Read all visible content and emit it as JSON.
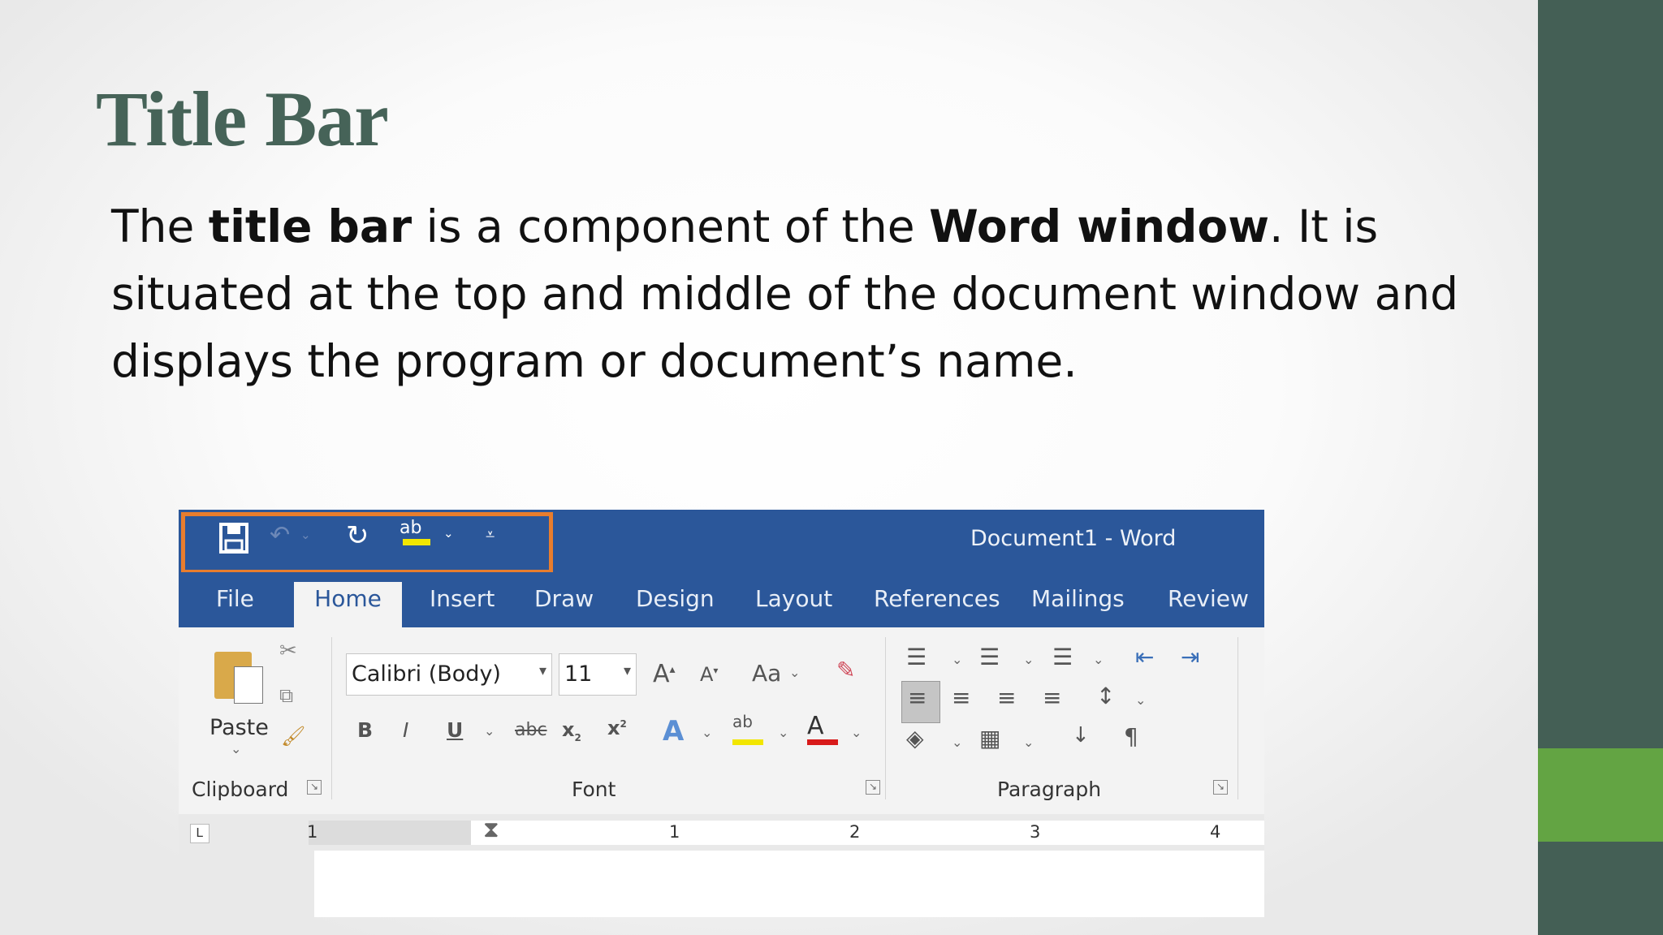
{
  "slide": {
    "title": "Title Bar",
    "body": {
      "p1": "The ",
      "b1": "title bar",
      "p2": " is a component of the ",
      "b2": "Word window",
      "p3": ". It is situated at the top and middle of the document window and displays the program or document’s name."
    }
  },
  "colors": {
    "title": "#466358",
    "sidebar": "#445f55",
    "sidebar_accent": "#63a443",
    "word_blue": "#2b579a",
    "highlight_box": "#e87d2e"
  },
  "word": {
    "title": "Document1  -  Word",
    "quick_access": {
      "icons": [
        "save-icon",
        "undo-icon",
        "redo-icon",
        "spelling-icon",
        "customize-icon"
      ]
    },
    "tabs": [
      "File",
      "Home",
      "Insert",
      "Draw",
      "Design",
      "Layout",
      "References",
      "Mailings",
      "Review"
    ],
    "active_tab": "Home",
    "ribbon": {
      "clipboard": {
        "paste": "Paste",
        "label": "Clipboard"
      },
      "font": {
        "name": "Calibri (Body)",
        "size": "11",
        "change_case": "Aa",
        "label": "Font",
        "bold": "B",
        "italic": "I",
        "underline": "U",
        "strike": "abc",
        "subscript": "x",
        "superscript": "x"
      },
      "paragraph": {
        "label": "Paragraph",
        "pilcrow": "¶"
      }
    },
    "ruler": [
      "1",
      "1",
      "2",
      "3",
      "4"
    ]
  }
}
